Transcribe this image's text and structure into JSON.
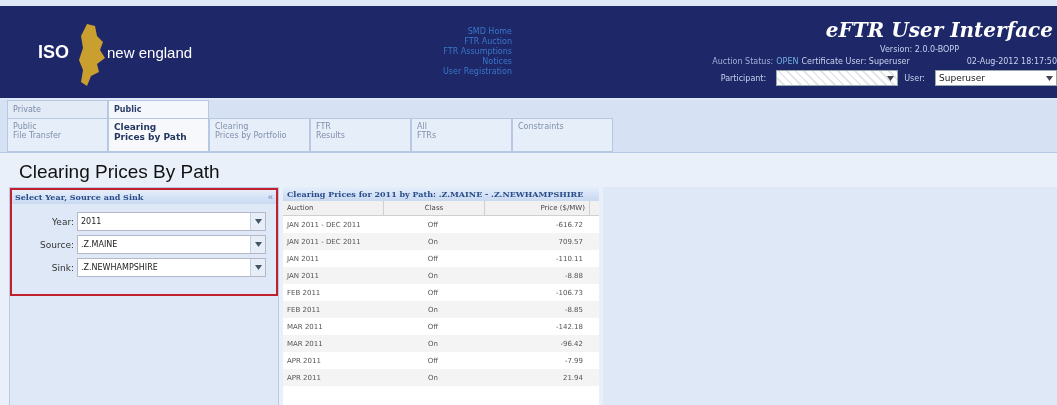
{
  "header": {
    "logo_mark": "ISO",
    "logo_text": "new england",
    "nav_links": [
      "SMD Home",
      "FTR Auction",
      "FTR Assumptions",
      "Notices",
      "User Registration"
    ],
    "app_title": "eFTR User Interface",
    "version": "Version: 2.0.0-BOPP",
    "auction_status_label": "Auction Status:",
    "auction_status": "OPEN",
    "certificate_user": "Certificate User: Superuser",
    "datetime": "02-Aug-2012 18:17:50",
    "participant_label": "Participant:",
    "user_label": "User:",
    "user_value": "Superuser"
  },
  "main_tabs": [
    {
      "label": "Private",
      "selected": false
    },
    {
      "label": "Public",
      "selected": true
    }
  ],
  "sub_tabs": [
    {
      "lines": [
        "Public",
        "File Transfer"
      ],
      "selected": false
    },
    {
      "lines": [
        "Clearing",
        "Prices by Path"
      ],
      "selected": true
    },
    {
      "lines": [
        "Clearing",
        "Prices by Portfolio"
      ],
      "selected": false
    },
    {
      "lines": [
        "FTR",
        "Results"
      ],
      "selected": false
    },
    {
      "lines": [
        "All",
        "FTRs"
      ],
      "selected": false
    },
    {
      "lines": [
        "Constraints"
      ],
      "selected": false
    }
  ],
  "page_title": "Clearing Prices By Path",
  "filter_panel": {
    "title": "Select Year, Source and Sink",
    "collapse": "«",
    "fields": [
      {
        "label": "Year:",
        "value": "2011"
      },
      {
        "label": "Source:",
        "value": ".Z.MAINE"
      },
      {
        "label": "Sink:",
        "value": ".Z.NEWHAMPSHIRE"
      }
    ]
  },
  "table": {
    "title": "Clearing Prices for 2011 by Path: .Z.MAINE - .Z.NEWHAMPSHIRE",
    "columns": [
      "Auction",
      "Class",
      "Price ($/MW)"
    ],
    "rows": [
      [
        "JAN 2011 - DEC 2011",
        "Off",
        "-616.72"
      ],
      [
        "JAN 2011 - DEC 2011",
        "On",
        "709.57"
      ],
      [
        "JAN 2011",
        "Off",
        "-110.11"
      ],
      [
        "JAN 2011",
        "On",
        "-8.88"
      ],
      [
        "FEB 2011",
        "Off",
        "-106.73"
      ],
      [
        "FEB 2011",
        "On",
        "-8.85"
      ],
      [
        "MAR 2011",
        "Off",
        "-142.18"
      ],
      [
        "MAR 2011",
        "On",
        "-96.42"
      ],
      [
        "APR 2011",
        "Off",
        "-7.99"
      ],
      [
        "APR 2011",
        "On",
        "21.94"
      ]
    ]
  }
}
